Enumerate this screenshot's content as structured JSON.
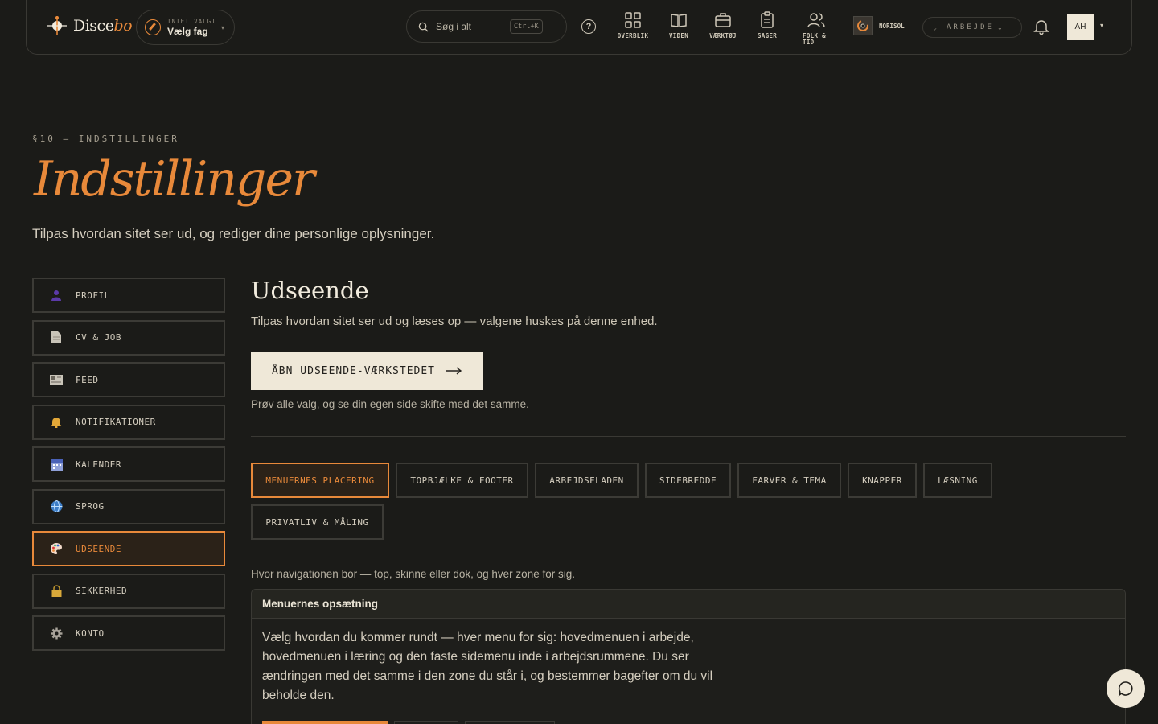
{
  "topbar": {
    "logo_text_a": "Disce",
    "logo_text_b": "bo",
    "subject_small": "INTET VALGT",
    "subject_main": "Vælg fag",
    "search_placeholder": "Søg i alt",
    "search_shortcut": "Ctrl+K",
    "nav": [
      {
        "label": "OVERBLIK",
        "icon": "grid-icon"
      },
      {
        "label": "VIDEN",
        "icon": "book-icon"
      },
      {
        "label": "VÆRKTØJ",
        "icon": "briefcase-icon"
      },
      {
        "label": "SAGER",
        "icon": "clipboard-icon"
      },
      {
        "label": "FOLK & TID",
        "icon": "people-icon"
      }
    ],
    "org_name": "NORISOL",
    "mode_label": "ARBEJDE",
    "avatar_initials": "AH"
  },
  "header": {
    "eyebrow": "§10 — INDSTILLINGER",
    "title": "Indstillinger",
    "subtitle": "Tilpas hvordan sitet ser ud, og rediger dine personlige oplysninger."
  },
  "sidebar": {
    "items": [
      {
        "label": "PROFIL",
        "icon": "person-icon"
      },
      {
        "label": "CV & JOB",
        "icon": "document-icon"
      },
      {
        "label": "FEED",
        "icon": "newspaper-icon"
      },
      {
        "label": "NOTIFIKATIONER",
        "icon": "bell-icon"
      },
      {
        "label": "KALENDER",
        "icon": "calendar-icon"
      },
      {
        "label": "SPROG",
        "icon": "globe-icon"
      },
      {
        "label": "UDSEENDE",
        "icon": "palette-icon",
        "active": true
      },
      {
        "label": "SIKKERHED",
        "icon": "lock-icon"
      },
      {
        "label": "KONTO",
        "icon": "gear-icon"
      }
    ]
  },
  "main": {
    "title": "Udseende",
    "subtitle": "Tilpas hvordan sitet ser ud og læses op — valgene huskes på denne enhed.",
    "cta_label": "ÅBN UDSEENDE-VÆRKSTEDET",
    "cta_note": "Prøv alle valg, og se din egen side skifte med det samme.",
    "tabs": [
      {
        "label": "MENUERNES PLACERING",
        "active": true
      },
      {
        "label": "TOPBJÆLKE & FOOTER"
      },
      {
        "label": "ARBEJDSFLADEN"
      },
      {
        "label": "SIDEBREDDE"
      },
      {
        "label": "FARVER & TEMA"
      },
      {
        "label": "KNAPPER"
      },
      {
        "label": "LÆSNING"
      },
      {
        "label": "PRIVATLIV & MÅLING"
      }
    ],
    "zone_note": "Hvor navigationen bor — top, skinne eller dok, og hver zone for sig.",
    "card_title": "Menuernes opsætning",
    "card_body": "Vælg hvordan du kommer rundt — hver menu for sig: hovedmenuen i arbejde, hovedmenuen i læring og den faste sidemenu inde i arbejdsrummene. Du ser ændringen med det samme i den zone du står i, og bestemmer bagefter om du vil beholde den."
  },
  "colors": {
    "accent": "#e8893a",
    "background": "#1b1b18",
    "cream": "#efe8d8"
  }
}
